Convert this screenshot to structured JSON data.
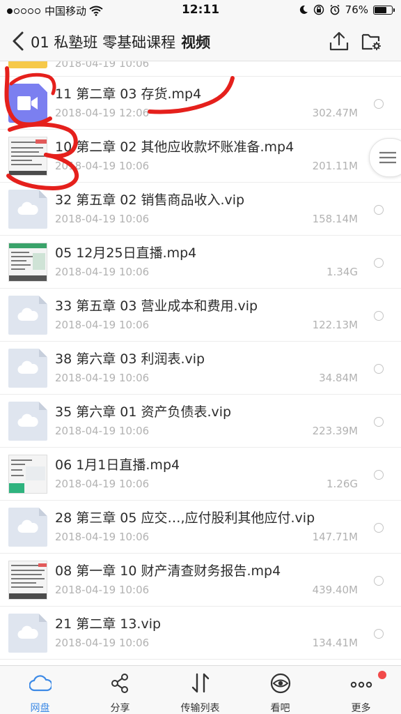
{
  "status_bar": {
    "carrier": "中国移动",
    "time": "12:11",
    "battery_percent": "76%",
    "battery_level": 0.76,
    "icons": [
      "signal-dots-icon",
      "wifi-icon",
      "moon-icon",
      "rotation-lock-icon",
      "alarm-icon",
      "battery-icon"
    ]
  },
  "nav": {
    "title": "01 私塾班 零基础课程",
    "title_bold": "视频",
    "icons": [
      "back-arrow-icon",
      "upload-icon",
      "folder-settings-icon"
    ]
  },
  "list": {
    "partial_top_date": "2018-04-19 10:06",
    "files": [
      {
        "name": "11 第二章 03 存货.mp4",
        "date": "2018-04-19 12:06",
        "size": "302.47M",
        "icon": "video-file-icon"
      },
      {
        "name": "10 第二章 02 其他应收款坏账准备.mp4",
        "date": "2018-04-19 10:06",
        "size": "201.11M",
        "icon": "video-thumbnail"
      },
      {
        "name": "32 第五章 02 销售商品收入.vip",
        "date": "2018-04-19 10:06",
        "size": "158.14M",
        "icon": "cloud-file-icon"
      },
      {
        "name": "05 12月25日直播.mp4",
        "date": "2018-04-19 10:06",
        "size": "1.34G",
        "icon": "video-thumbnail"
      },
      {
        "name": "33 第五章 03 营业成本和费用.vip",
        "date": "2018-04-19 10:06",
        "size": "122.13M",
        "icon": "cloud-file-icon"
      },
      {
        "name": "38 第六章 03 利润表.vip",
        "date": "2018-04-19 10:06",
        "size": "34.84M",
        "icon": "cloud-file-icon"
      },
      {
        "name": "35 第六章 01 资产负债表.vip",
        "date": "2018-04-19 10:06",
        "size": "223.39M",
        "icon": "cloud-file-icon"
      },
      {
        "name": "06 1月1日直播.mp4",
        "date": "2018-04-19 10:06",
        "size": "1.26G",
        "icon": "video-thumbnail"
      },
      {
        "name": "28 第三章 05 应交…,应付股利其他应付.vip",
        "date": "2018-04-19 10:06",
        "size": "147.71M",
        "icon": "cloud-file-icon"
      },
      {
        "name": "08 第一章 10 财产清查财务报告.mp4",
        "date": "2018-04-19 10:06",
        "size": "439.40M",
        "icon": "video-thumbnail"
      },
      {
        "name": "21 第二章 13.vip",
        "date": "2018-04-19 10:06",
        "size": "134.41M",
        "icon": "cloud-file-icon"
      }
    ]
  },
  "tabs": [
    {
      "label": "网盘",
      "icon": "cloud-icon",
      "active": true
    },
    {
      "label": "分享",
      "icon": "share-icon",
      "active": false
    },
    {
      "label": "传输列表",
      "icon": "transfer-arrows-icon",
      "active": false
    },
    {
      "label": "看吧",
      "icon": "eye-icon",
      "active": false
    },
    {
      "label": "更多",
      "icon": "more-dots-icon",
      "active": false
    }
  ],
  "colors": {
    "accent": "#3d8ae6",
    "badge": "#f24a4a",
    "annotation": "#e5201c",
    "video_icon": "#7b7ff0",
    "cloud_file": "#dfe5ef"
  }
}
